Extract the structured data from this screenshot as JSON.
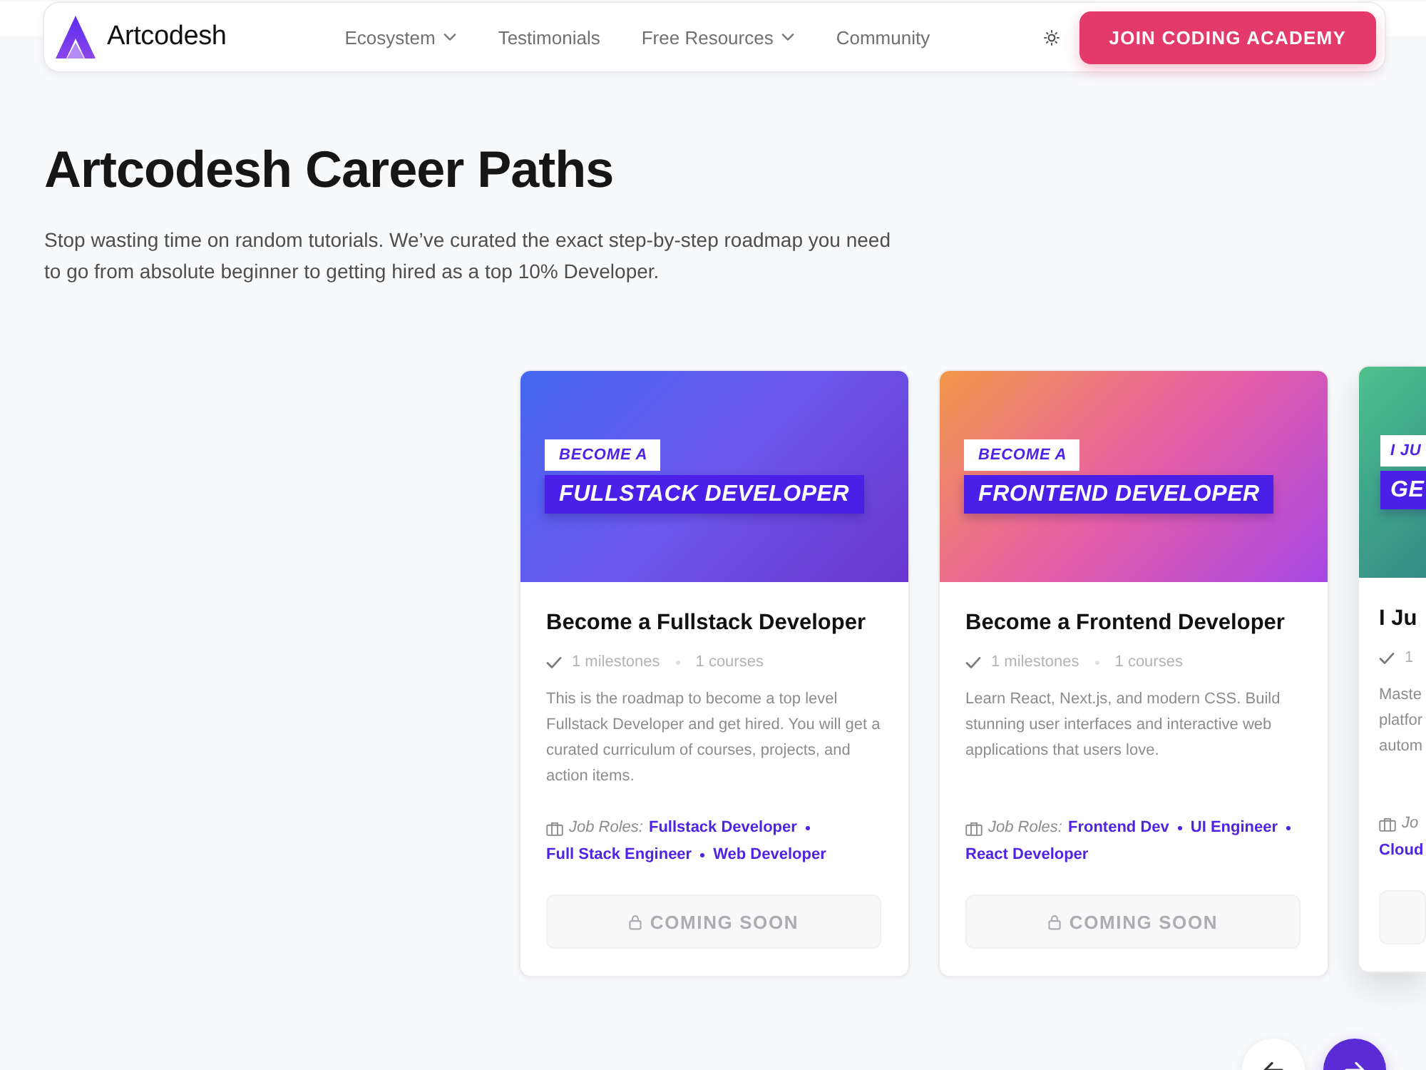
{
  "nav": {
    "brand": "Artcodesh",
    "links": [
      {
        "label": "Ecosystem",
        "dropdown": true
      },
      {
        "label": "Testimonials",
        "dropdown": false
      },
      {
        "label": "Free Resources",
        "dropdown": true
      },
      {
        "label": "Community",
        "dropdown": false
      }
    ],
    "cta": "JOIN CODING ACADEMY"
  },
  "hero": {
    "title": "Artcodesh Career Paths",
    "subtitle": "Stop wasting time on random tutorials. We’ve curated the exact step-by-step roadmap you need to go from absolute beginner to getting hired as a top 10% Developer."
  },
  "paths": [
    {
      "hovered": false,
      "banner": {
        "kicker": "BECOME A",
        "headline": "FULLSTACK DEVELOPER",
        "gradient": [
          {
            "color": "#4467f0"
          },
          {
            "color": "#6c57ec"
          },
          {
            "color": "#6a35cf"
          }
        ]
      },
      "title": "Become a Fullstack Developer",
      "milestones": "1 milestones",
      "courses": "1 courses",
      "description": "This is the roadmap to become a top level Fullstack Developer and get hired. You will get a curated curriculum of courses, projects, and action items.",
      "roles_label": "Job Roles:",
      "roles": [
        "Fullstack Developer",
        "Full Stack Engineer",
        "Web Developer"
      ],
      "button": {
        "label": "COMING SOON",
        "disabled": true
      }
    },
    {
      "hovered": false,
      "banner": {
        "kicker": "BECOME A",
        "headline": "FRONTEND DEVELOPER",
        "gradient": [
          {
            "color": "#f2984a"
          },
          {
            "color": "#e65fa6"
          },
          {
            "color": "#a747e4"
          }
        ]
      },
      "title": "Become a Frontend Developer",
      "milestones": "1 milestones",
      "courses": "1 courses",
      "description": "Learn React, Next.js, and modern CSS. Build stunning user interfaces and interactive web applications that users love.",
      "roles_label": "Job Roles:",
      "roles": [
        "Frontend Dev",
        "UI Engineer",
        "React Developer"
      ],
      "button": {
        "label": "COMING SOON",
        "disabled": true
      }
    },
    {
      "hovered": true,
      "banner": {
        "kicker": "I JU",
        "headline": "GE",
        "gradient": [
          {
            "color": "#4fc18d"
          },
          {
            "color": "#3fa58a"
          },
          {
            "color": "#368c86"
          }
        ]
      },
      "title": "I Ju",
      "milestones": "1",
      "description": "Maste platfor autom",
      "roles_label": "Jo",
      "roles": [
        "Cloud"
      ],
      "button": {
        "disabled": true
      }
    }
  ]
}
